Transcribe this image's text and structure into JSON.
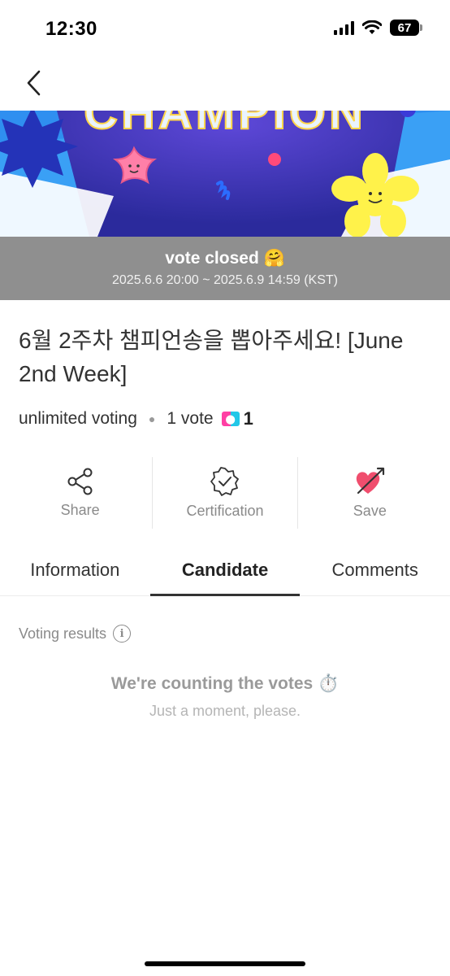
{
  "status_bar": {
    "time": "12:30",
    "battery": "67"
  },
  "banner": {
    "heading": "CHAMPION"
  },
  "vote_status": {
    "title": "vote closed 🤗",
    "period": "2025.6.6 20:00 ~ 2025.6.9 14:59 (KST)"
  },
  "vote": {
    "title": "6월 2주차 챔피언송을 뽑아주세요! [June 2nd Week]",
    "voting_type": "unlimited voting",
    "vote_count": "1 vote",
    "ticket_count": "1"
  },
  "actions": [
    {
      "label": "Share",
      "icon": "share-icon"
    },
    {
      "label": "Certification",
      "icon": "certification-badge-icon"
    },
    {
      "label": "Save",
      "icon": "heart-arrow-icon"
    }
  ],
  "tabs": [
    {
      "label": "Information",
      "active": false
    },
    {
      "label": "Candidate",
      "active": true
    },
    {
      "label": "Comments",
      "active": false
    }
  ],
  "results": {
    "label": "Voting results",
    "counting_title": "We're counting the votes ⏱️",
    "counting_sub": "Just a moment, please."
  },
  "colors": {
    "accent_pink": "#f04e6e",
    "overlay_gray": "#8f8f8f",
    "banner_blue": "#2d8cf0"
  }
}
